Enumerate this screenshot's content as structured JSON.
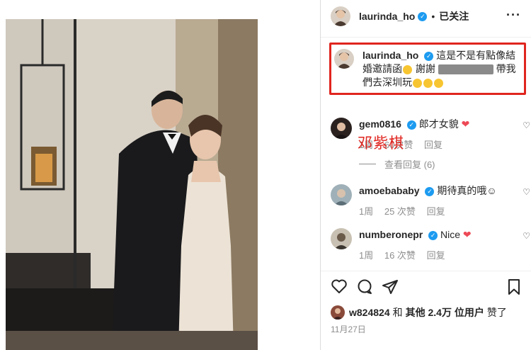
{
  "post": {
    "author": "laurinda_ho",
    "follow_status": "已关注",
    "dot": "•",
    "more_glyph": "···"
  },
  "caption": {
    "author": "laurinda_ho",
    "text_a": "這是不是有點像結婚邀請函",
    "text_b": "謝謝",
    "text_c": "帶我們去深圳玩"
  },
  "watermark": "邓紫棋",
  "comments": [
    {
      "user": "gem0816",
      "text": "郎才女貌",
      "time": "1周",
      "likes": "60次赞",
      "reply": "回复",
      "verified": true,
      "heart": true
    },
    {
      "user": "amoebababy",
      "text": "期待真的哦☺",
      "time": "1周",
      "likes": "25 次赞",
      "reply": "回复",
      "verified": true,
      "heart": false
    },
    {
      "user": "numberonepr",
      "text": "Nice",
      "time": "1周",
      "likes": "16 次赞",
      "reply": "回复",
      "verified": true,
      "heart": true
    }
  ],
  "view_replies": "查看回复 (6)",
  "likes": {
    "user": "w824824",
    "connector": "和",
    "others": "其他 2.4万 位用户",
    "suffix": "赞了"
  },
  "date": "11月27日",
  "colors": {
    "verified": "#1d9bf0",
    "highlight_border": "#e0251f",
    "heart": "#ed4956"
  },
  "icons": [
    "more-icon",
    "heart-icon",
    "comment-icon",
    "share-icon",
    "bookmark-icon",
    "verified-icon"
  ]
}
